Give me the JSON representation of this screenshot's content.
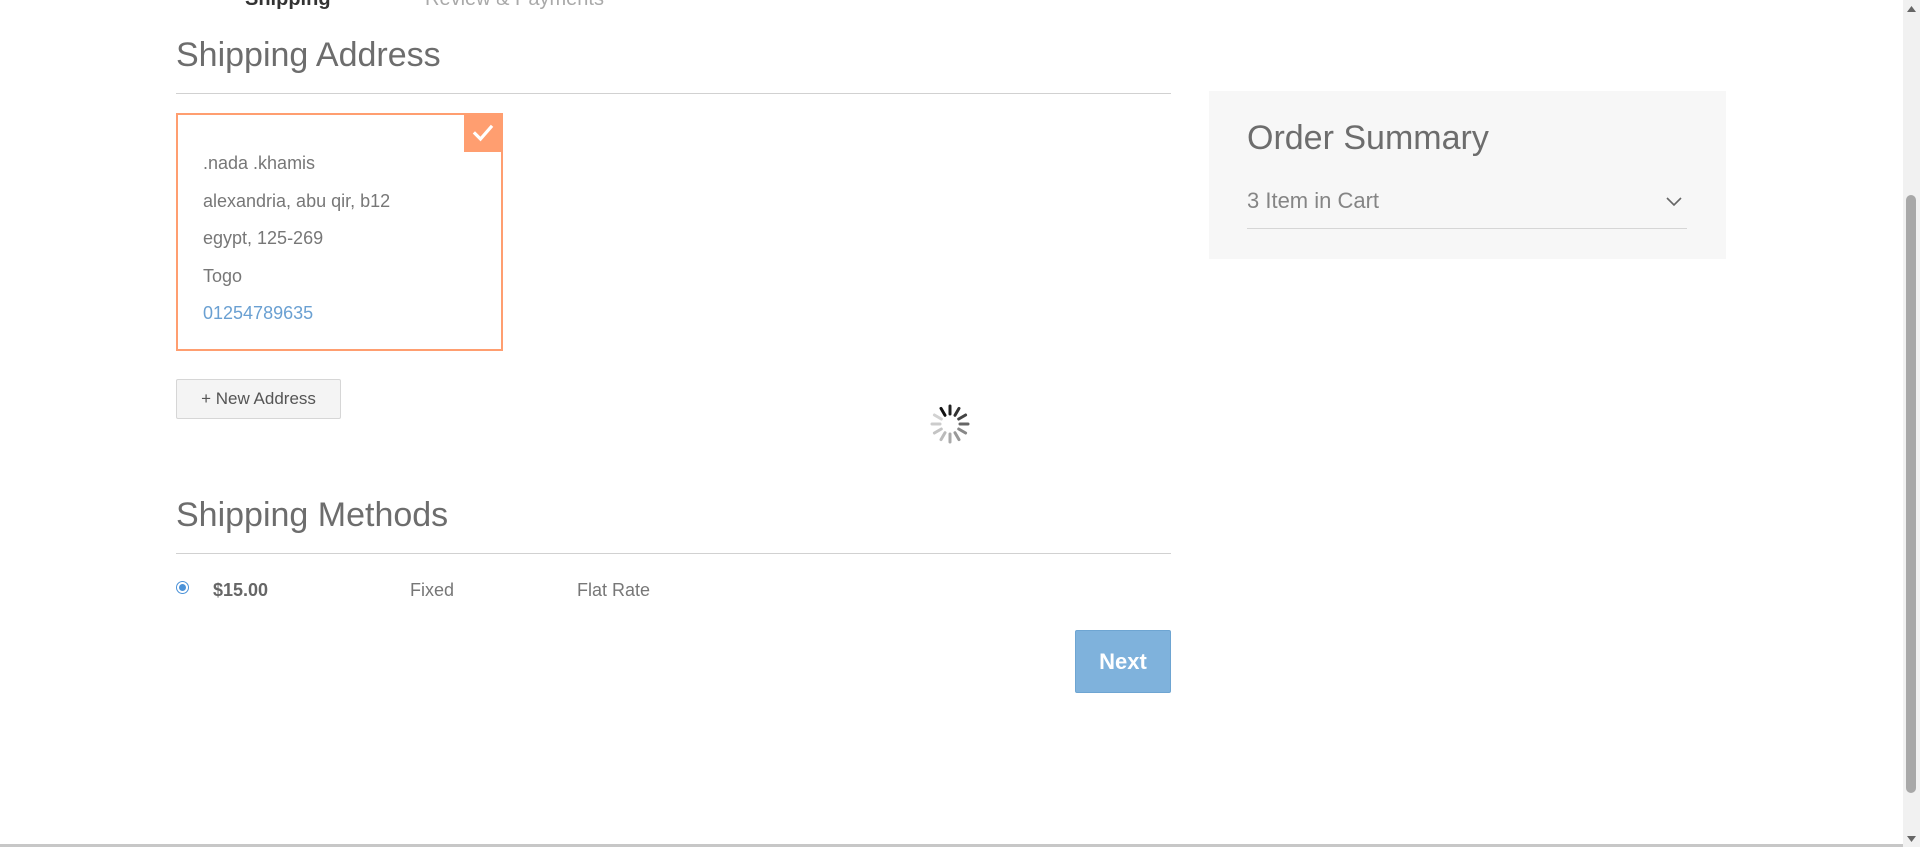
{
  "steps": {
    "shipping_label": "Shipping",
    "review_label": "Review & Payments"
  },
  "shipping_address": {
    "title": "Shipping Address",
    "address": {
      "name": ".nada .khamis",
      "street": "alexandria, abu qir, b12",
      "city_zip": "egypt, 125-269",
      "country": "Togo",
      "phone": "01254789635"
    },
    "new_address_label": "+ New Address"
  },
  "shipping_methods": {
    "title": "Shipping Methods",
    "method": {
      "price": "$15.00",
      "type": "Fixed",
      "carrier": "Flat Rate"
    },
    "next_label": "Next"
  },
  "order_summary": {
    "title": "Order Summary",
    "items_text": "3 Item in Cart"
  },
  "colors": {
    "accent_orange": "#ff9e70",
    "button_blue": "#7fb2dc",
    "link_blue": "#6aa0d2"
  }
}
